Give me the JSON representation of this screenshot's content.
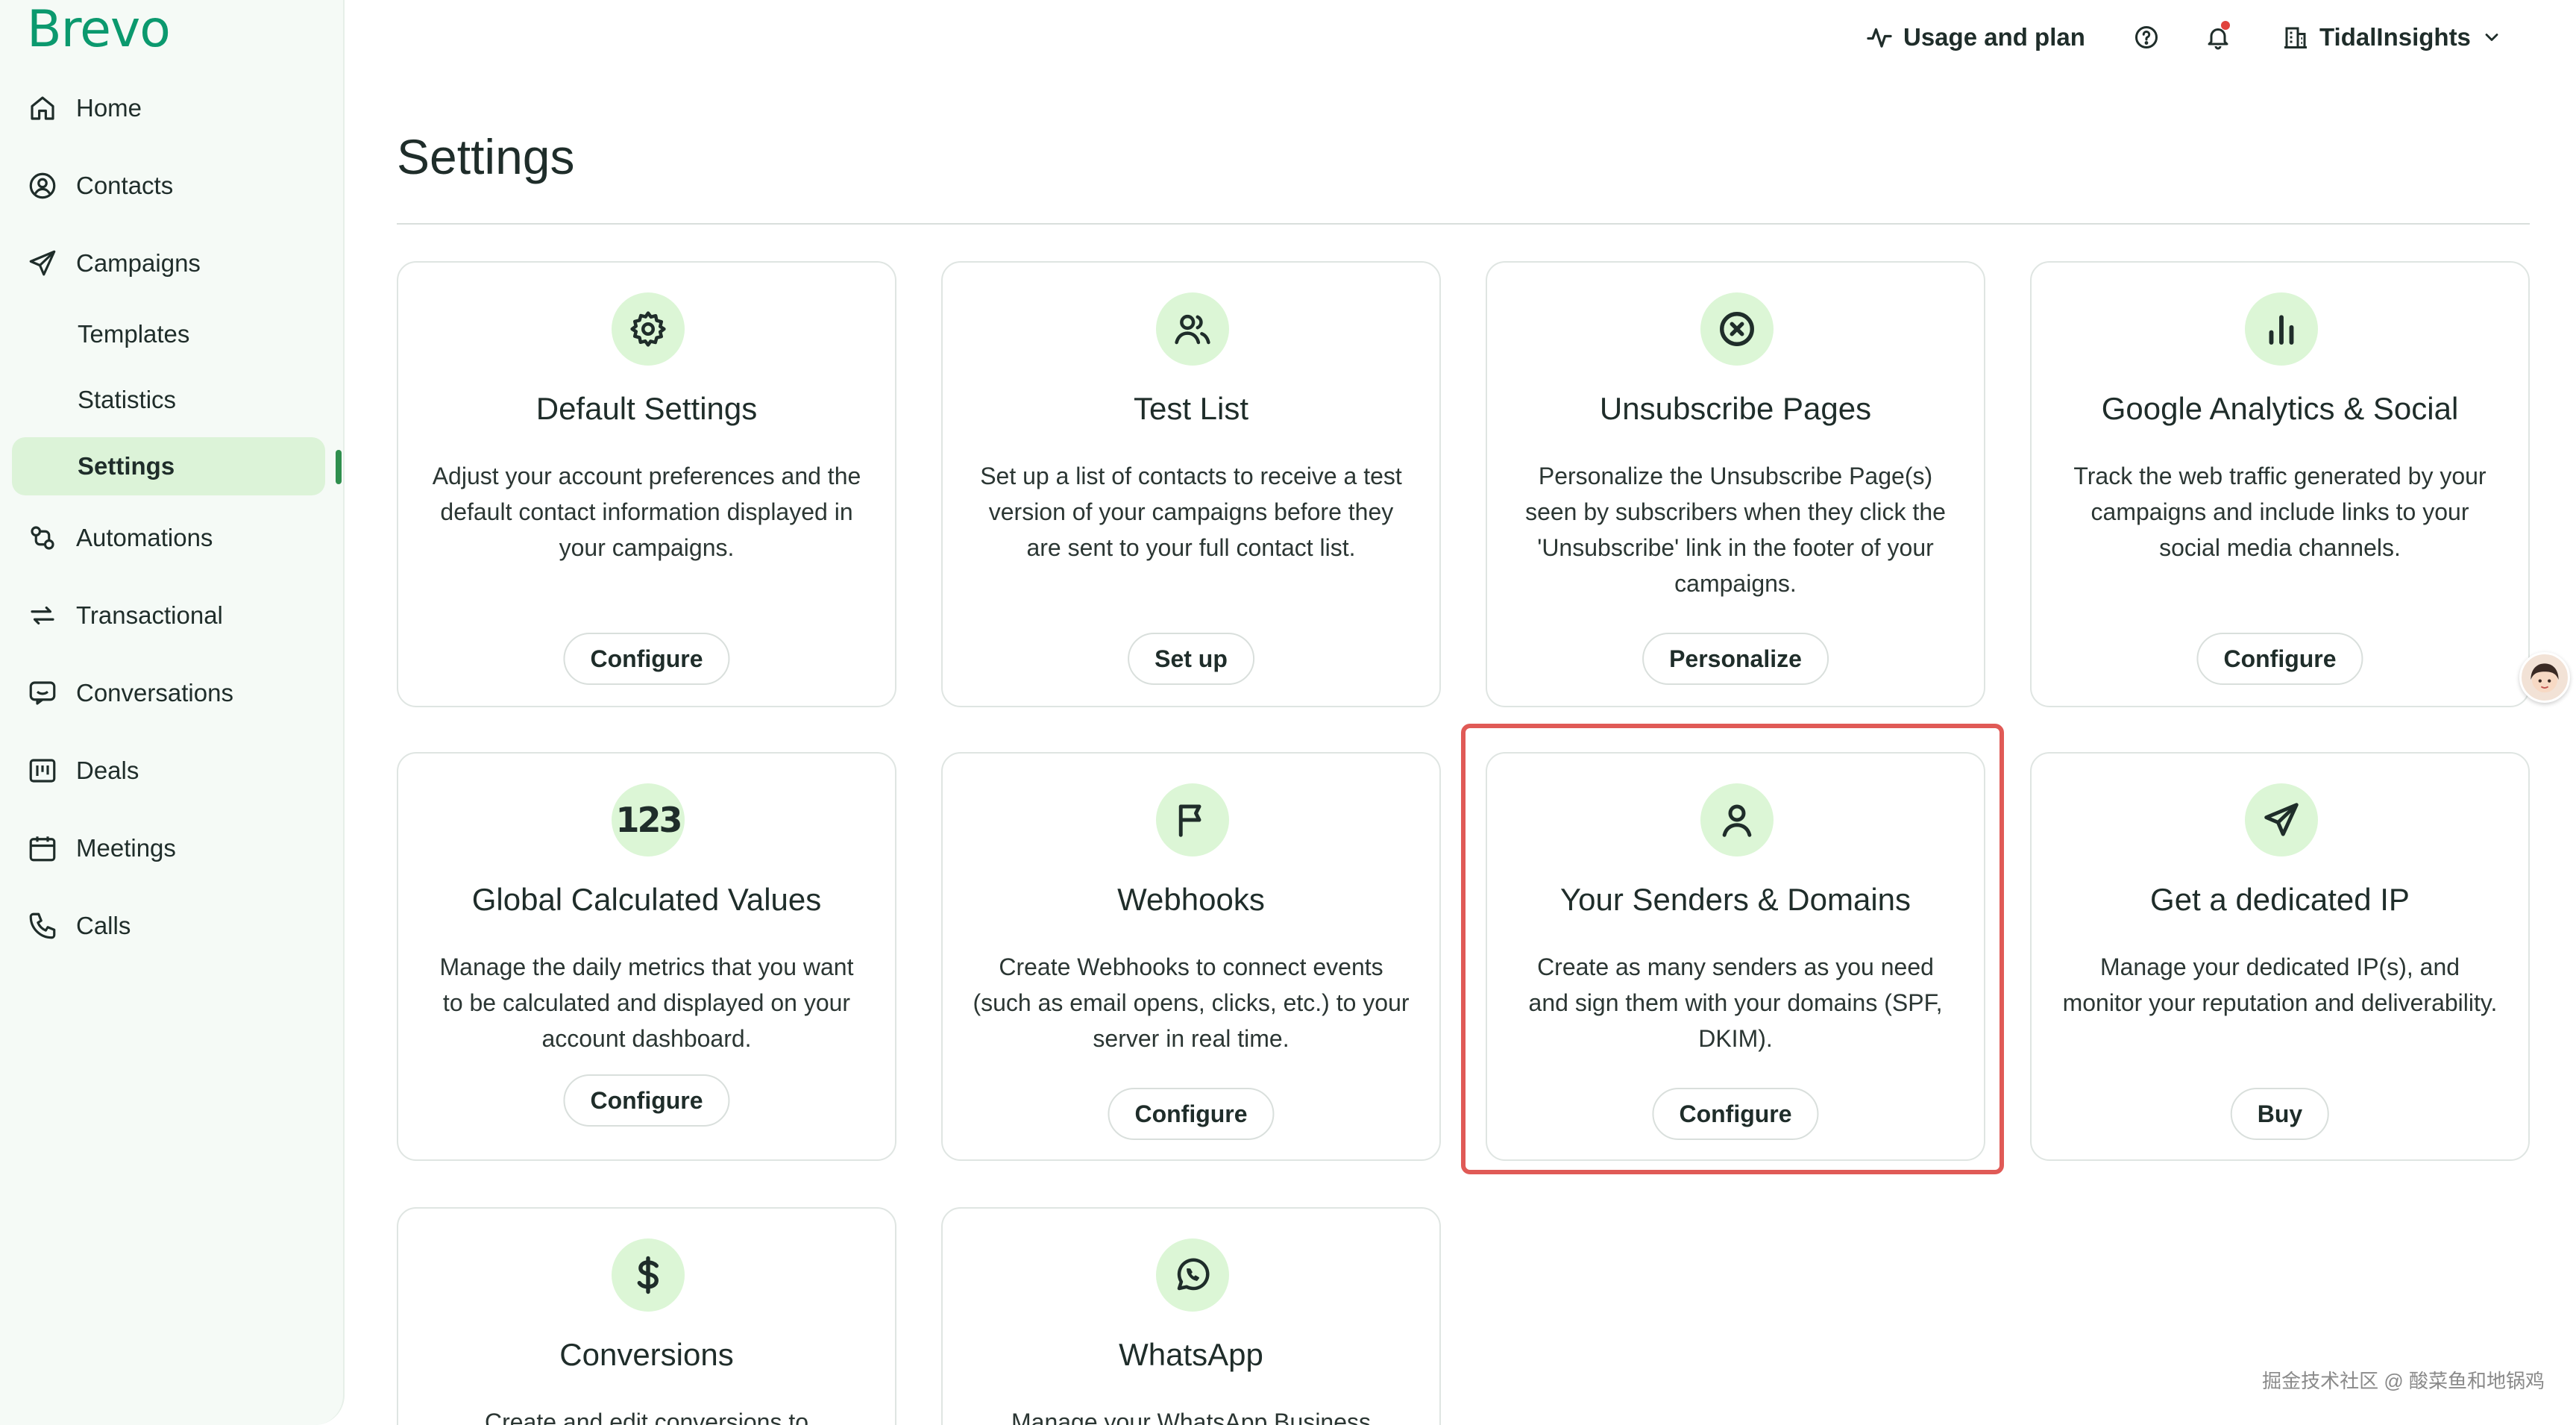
{
  "brand": {
    "logo_text": "Brevo",
    "accent": "#0b996e",
    "active_bg": "#dcf3d8",
    "icon_bg": "#dcf6d6",
    "highlight": "#e05a56"
  },
  "sidebar": {
    "items": [
      {
        "label": "Home",
        "icon": "home-icon"
      },
      {
        "label": "Contacts",
        "icon": "contacts-icon"
      },
      {
        "label": "Campaigns",
        "icon": "send-icon"
      },
      {
        "label": "Templates"
      },
      {
        "label": "Statistics"
      },
      {
        "label": "Settings",
        "active": true
      },
      {
        "label": "Automations",
        "icon": "automations-icon"
      },
      {
        "label": "Transactional",
        "icon": "transactional-icon"
      },
      {
        "label": "Conversations",
        "icon": "chat-icon"
      },
      {
        "label": "Deals",
        "icon": "deals-icon"
      },
      {
        "label": "Meetings",
        "icon": "calendar-icon"
      },
      {
        "label": "Calls",
        "icon": "phone-icon"
      }
    ]
  },
  "topbar": {
    "usage_label": "Usage and plan",
    "account_label": "TidalInsights"
  },
  "main": {
    "title": "Settings",
    "cards": [
      {
        "title": "Default Settings",
        "description": "Adjust your account preferences and the default contact information displayed in your campaigns.",
        "button": "Configure",
        "icon": "gear-icon"
      },
      {
        "title": "Test List",
        "description": "Set up a list of contacts to receive a test version of your campaigns before they are sent to your full contact list.",
        "button": "Set up",
        "icon": "users-icon"
      },
      {
        "title": "Unsubscribe Pages",
        "description": "Personalize the Unsubscribe Page(s) seen by subscribers when they click the 'Unsubscribe' link in the footer of your campaigns.",
        "button": "Personalize",
        "icon": "x-circle-icon"
      },
      {
        "title": "Google Analytics & Social",
        "description": "Track the web traffic generated by your campaigns and include links to your social media channels.",
        "button": "Configure",
        "icon": "bar-chart-icon"
      },
      {
        "title": "Global Calculated Values",
        "description": "Manage the daily metrics that you want to be calculated and displayed on your account dashboard.",
        "button": "Configure",
        "icon": "numbers-icon"
      },
      {
        "title": "Webhooks",
        "description": "Create Webhooks to connect events (such as email opens, clicks, etc.) to your server in real time.",
        "button": "Configure",
        "icon": "flag-icon"
      },
      {
        "title": "Your Senders & Domains",
        "description": "Create as many senders as you need and sign them with your domains (SPF, DKIM).",
        "button": "Configure",
        "icon": "user-icon"
      },
      {
        "title": "Get a dedicated IP",
        "description": "Manage your dedicated IP(s), and monitor your reputation and deliverability.",
        "button": "Buy",
        "icon": "send-icon"
      },
      {
        "title": "Conversions",
        "description": "Create and edit conversions to",
        "icon": "dollar-icon"
      },
      {
        "title": "WhatsApp",
        "description": "Manage your WhatsApp Business",
        "icon": "whatsapp-icon"
      }
    ],
    "numbers_glyph": "123"
  },
  "watermark": "掘金技术社区 @ 酸菜鱼和地锅鸡"
}
